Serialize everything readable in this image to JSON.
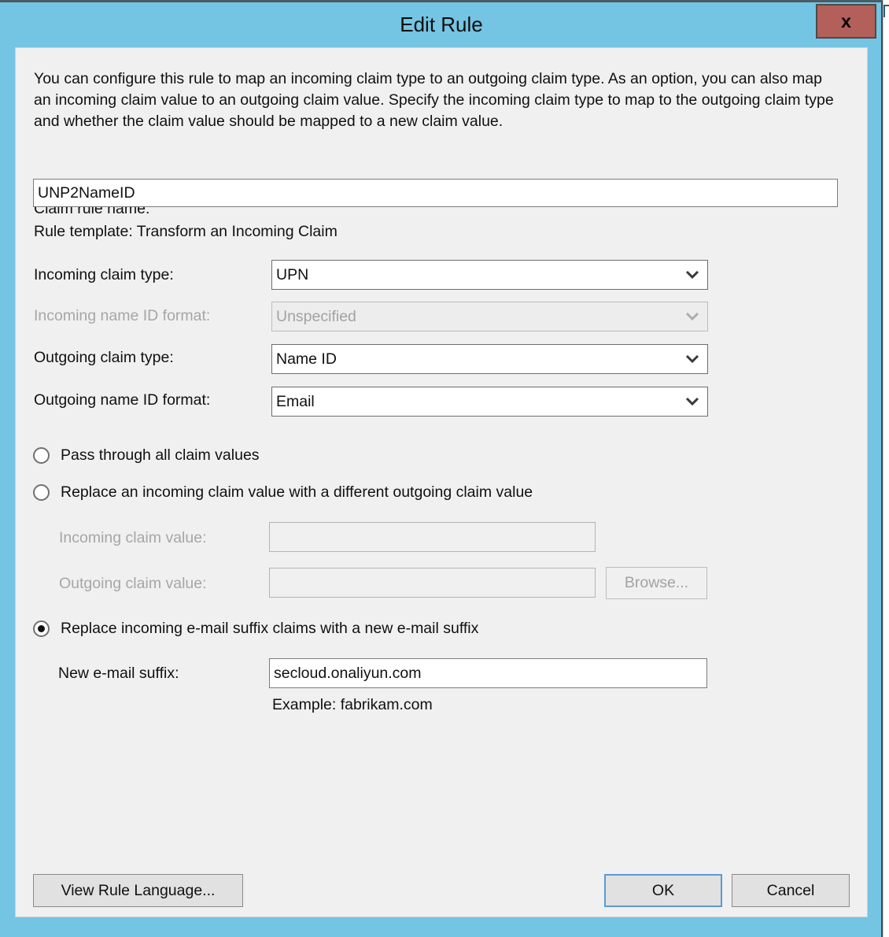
{
  "window": {
    "title": "Edit Rule",
    "close_label": "x",
    "chrome_color": "#74c4e3",
    "close_color": "#b3605a",
    "panel_color": "#f0f0f0"
  },
  "intro": {
    "text": "You can configure this rule to map an incoming claim type to an outgoing claim type. As an option, you can also map an incoming claim value to an outgoing claim value. Specify the incoming claim type to map to the outgoing claim type and whether the claim value should be mapped to a new claim value."
  },
  "rule_name": {
    "label": "Claim rule name:",
    "value": "UNP2NameID"
  },
  "rule_template": {
    "text": "Rule template: Transform an Incoming Claim"
  },
  "fields": {
    "incoming_claim_type": {
      "label": "Incoming claim type:",
      "value": "UPN",
      "enabled": true
    },
    "incoming_name_id_format": {
      "label": "Incoming name ID format:",
      "value": "Unspecified",
      "enabled": false
    },
    "outgoing_claim_type": {
      "label": "Outgoing claim type:",
      "value": "Name ID",
      "enabled": true
    },
    "outgoing_name_id_format": {
      "label": "Outgoing name ID format:",
      "value": "Email",
      "enabled": true
    }
  },
  "options": {
    "pass_through": {
      "label": "Pass through all claim values",
      "selected": false
    },
    "replace_value": {
      "label": "Replace an incoming claim value with a different outgoing claim value",
      "selected": false
    },
    "replace_suffix": {
      "label": "Replace incoming e-mail suffix claims with a new e-mail suffix",
      "selected": true
    }
  },
  "claim_values": {
    "incoming_label": "Incoming claim value:",
    "incoming_value": "",
    "outgoing_label": "Outgoing claim value:",
    "outgoing_value": "",
    "browse_label": "Browse..."
  },
  "email_suffix": {
    "label": "New e-mail suffix:",
    "value": "secloud.onaliyun.com",
    "example": "Example: fabrikam.com"
  },
  "footer": {
    "view_rule_language": "View Rule Language...",
    "ok": "OK",
    "cancel": "Cancel"
  }
}
